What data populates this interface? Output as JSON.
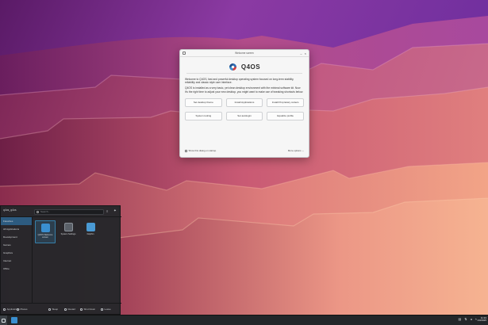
{
  "dialog": {
    "title": "Welcome screen",
    "brand": "Q4OS",
    "intro": "Welcome to Q4OS, fast and powerful desktop operating system focused on long-term stability, reliability and classic style user interface.",
    "body": "Q4OS is installed as a very basic, yet clean desktop environment with the minimal software kit. Now it's the right time to adjust your new desktop, you might want to make use of tweaking shortcuts below.",
    "buttons": [
      "Set desktop theme",
      "Install Applications",
      "Install Proprietary codecs",
      "System tooling",
      "Set autologin",
      "Equalize profile"
    ],
    "show_on_startup": "Show this dialog on startup",
    "more_options": "More options"
  },
  "launcher": {
    "user": "q4os_q4os",
    "search_placeholder": "Search...",
    "categories": [
      "Favorites",
      "All Applications",
      "Development",
      "Games",
      "Graphics",
      "Internet",
      "Office"
    ],
    "selected_category": 0,
    "apps": [
      "Q4OS Welcome screen",
      "System Settings",
      "Dolphin"
    ],
    "bottom": {
      "applications": "Applications",
      "places": "Places",
      "sleep": "Sleep",
      "restart": "Restart",
      "shutdown": "Shut Down",
      "leave": "Leave"
    }
  },
  "taskbar": {
    "time": "11:33",
    "date": "1/3/2025"
  },
  "colors": {
    "accent": "#3daee9",
    "panel": "#232629",
    "launcher_bg": "#24262a",
    "wallpaper_deep": "#3b1c63",
    "wallpaper_mid": "#b3457d",
    "wallpaper_light": "#f0a184"
  }
}
